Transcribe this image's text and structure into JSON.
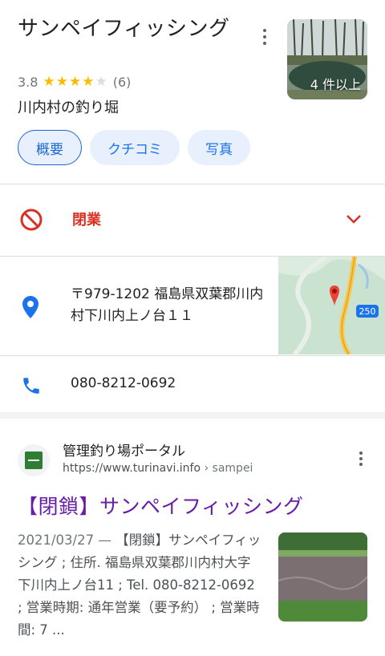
{
  "place": {
    "title": "サンペイフィッシング",
    "rating": "3.8",
    "rating_value": 3.8,
    "stars_max": 5,
    "review_count": "(6)",
    "category": "川内村の釣り堀",
    "photo_count_label": "4 件以上"
  },
  "tabs": [
    {
      "label": "概要"
    },
    {
      "label": "クチコミ"
    },
    {
      "label": "写真"
    }
  ],
  "status": {
    "label": "閉業",
    "color": "#d93025"
  },
  "address": {
    "line": "〒979-1202 福島県双葉郡川内村下川内上ノ台１１"
  },
  "map": {
    "road_number": "250"
  },
  "phone": {
    "number": "080-8212-0692"
  },
  "search_result": {
    "site_name": "管理釣り場ポータル",
    "url": "https://www.turinavi.info",
    "breadcrumb": " › sampei",
    "title": "【閉鎖】サンペイフィッシング",
    "date": "2021/03/27 — ",
    "snippet": "【閉鎖】サンペイフィッシング ; 住所. 福島県双葉郡川内村大字下川内上ノ台11 ; Tel. 080-8212-0692 ; 営業時期: 通年営業（要予約） ; 営業時間: 7 ..."
  },
  "colors": {
    "accent": "#1a73e8",
    "visited_link": "#681da8",
    "star": "#fbbc04"
  }
}
